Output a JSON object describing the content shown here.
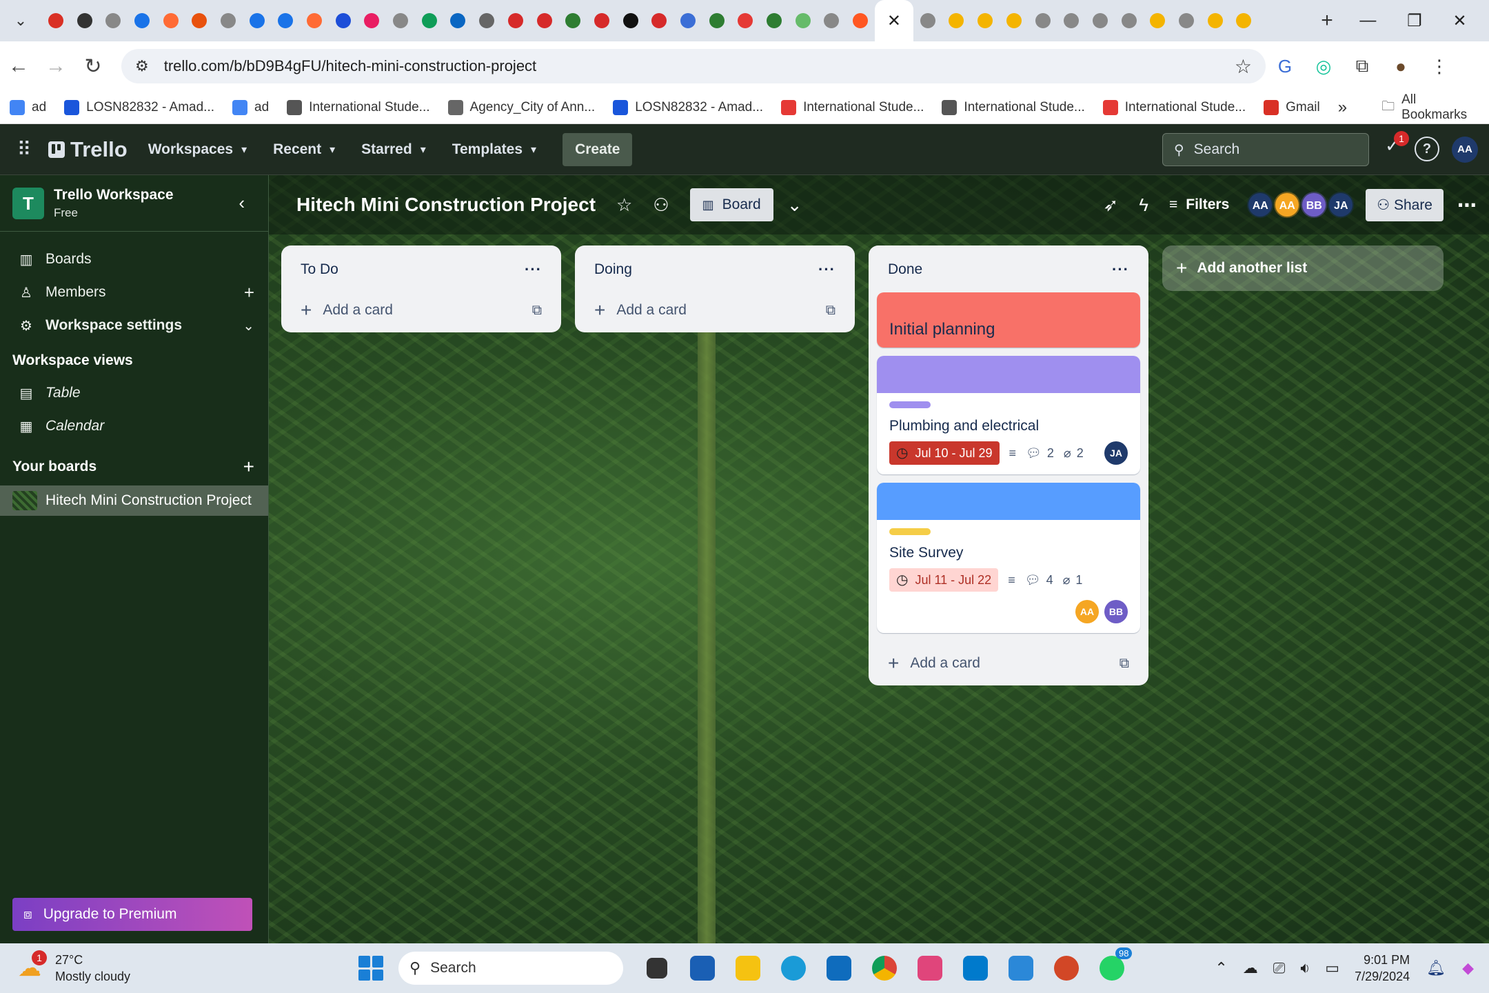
{
  "browser": {
    "url": "trello.com/b/bD9B4gFU/hitech-mini-construction-project",
    "tab_favicon_colors": [
      "#d93025",
      "#333333",
      "#888888",
      "#1a73e8",
      "#ff6b35",
      "#e8510d",
      "#888888",
      "#1a73e8",
      "#1a73e8",
      "#ff6b35",
      "#1d4ed8",
      "#e91e63",
      "#888888",
      "#0f9d58",
      "#0a66c2",
      "#666666",
      "#d62a2a",
      "#d62a2a",
      "#2e7d32",
      "#d62a2a",
      "#111111",
      "#d62a2a",
      "#3b6ed6",
      "#2e7d32",
      "#e53935",
      "#2e7d32",
      "#66bb6a",
      "#888888",
      "#ff5722"
    ],
    "tab_favicon_colors_right": [
      "#888888",
      "#f4b400",
      "#f4b400",
      "#f4b400",
      "#888888",
      "#888888",
      "#888888",
      "#888888",
      "#f4b400",
      "#888888",
      "#f4b400",
      "#f4b400"
    ],
    "bookmarks": [
      {
        "label": "ad",
        "color": "#4285f4"
      },
      {
        "label": "LOSN82832 - Amad...",
        "color": "#1a56db"
      },
      {
        "label": "ad",
        "color": "#4285f4"
      },
      {
        "label": "International Stude...",
        "color": "#555555"
      },
      {
        "label": "Agency_City of Ann...",
        "color": "#666666"
      },
      {
        "label": "LOSN82832 - Amad...",
        "color": "#1a56db"
      },
      {
        "label": "International Stude...",
        "color": "#e53935"
      },
      {
        "label": "International Stude...",
        "color": "#555555"
      },
      {
        "label": "International Stude...",
        "color": "#e53935"
      },
      {
        "label": "Gmail",
        "color": "#d93025"
      }
    ],
    "all_bookmarks": "All Bookmarks"
  },
  "header": {
    "logo": "Trello",
    "menus": [
      "Workspaces",
      "Recent",
      "Starred",
      "Templates"
    ],
    "create": "Create",
    "search_placeholder": "Search",
    "notification_count": "1",
    "avatar": "AA"
  },
  "sidebar": {
    "workspace_initial": "T",
    "workspace_name": "Trello Workspace",
    "workspace_plan": "Free",
    "items": [
      "Boards",
      "Members",
      "Workspace settings"
    ],
    "views_heading": "Workspace views",
    "views": [
      "Table",
      "Calendar"
    ],
    "boards_heading": "Your boards",
    "boards": [
      "Hitech Mini Construction Project"
    ],
    "upgrade": "Upgrade to Premium"
  },
  "board": {
    "title": "Hitech Mini Construction Project",
    "view": "Board",
    "filters": "Filters",
    "members": [
      {
        "initials": "AA",
        "color": "#1f3a6b"
      },
      {
        "initials": "AA",
        "color": "#f5a623"
      },
      {
        "initials": "BB",
        "color": "#6e5dc6"
      },
      {
        "initials": "JA",
        "color": "#1f3a6b"
      }
    ],
    "share": "Share",
    "add_list": "Add another list"
  },
  "lists": {
    "todo": {
      "title": "To Do",
      "add_card": "Add a card"
    },
    "doing": {
      "title": "Doing",
      "add_card": "Add a card"
    },
    "done": {
      "title": "Done",
      "add_card": "Add a card",
      "cards": [
        {
          "title": "Initial planning",
          "cover": "#f87168"
        },
        {
          "title": "Plumbing and electrical",
          "cover": "#9f8fef",
          "label_color": "#9f8fef",
          "dates": "Jul 10 - Jul 29",
          "date_style": "overdue",
          "comments": "2",
          "attachments": "2",
          "members": [
            {
              "initials": "JA",
              "color": "#1f3a6b"
            }
          ]
        },
        {
          "title": "Site Survey",
          "cover": "#579dff",
          "label_color": "#f5cd47",
          "dates": "Jul 11 - Jul 22",
          "date_style": "due",
          "comments": "4",
          "attachments": "1",
          "members": [
            {
              "initials": "AA",
              "color": "#f5a623"
            },
            {
              "initials": "BB",
              "color": "#6e5dc6"
            }
          ]
        }
      ]
    }
  },
  "taskbar": {
    "weather_temp": "27°C",
    "weather_desc": "Mostly cloudy",
    "weather_badge": "1",
    "search": "Search",
    "whatsapp_badge": "98",
    "time": "9:01 PM",
    "date": "7/29/2024"
  }
}
